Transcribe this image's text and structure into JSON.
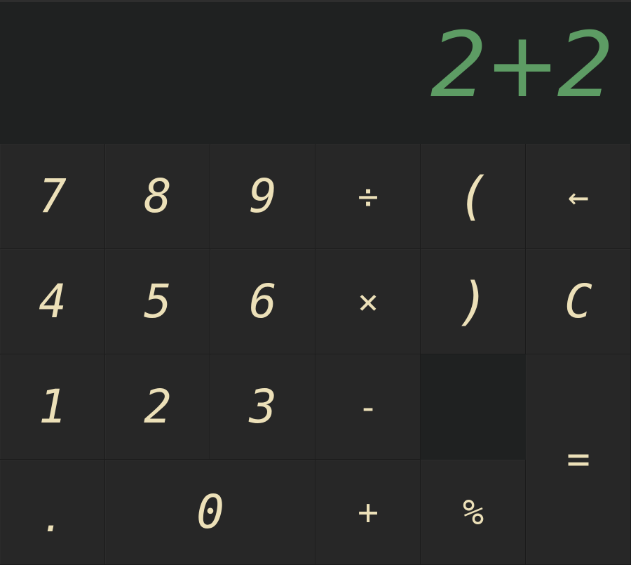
{
  "display": {
    "expression": "2+2"
  },
  "keys": {
    "seven": "7",
    "eight": "8",
    "nine": "9",
    "divide": "÷",
    "open_paren": "(",
    "backspace": "←",
    "four": "4",
    "five": "5",
    "six": "6",
    "multiply": "×",
    "close_paren": ")",
    "clear": "C",
    "one": "1",
    "two": "2",
    "three": "3",
    "minus": "-",
    "dot": ".",
    "zero": "0",
    "plus": "+",
    "percent": "%",
    "equals": "="
  },
  "colors": {
    "display_text": "#5d9c64",
    "key_text": "#ece0b8",
    "key_background": "#272727",
    "display_background": "#1f2121"
  }
}
